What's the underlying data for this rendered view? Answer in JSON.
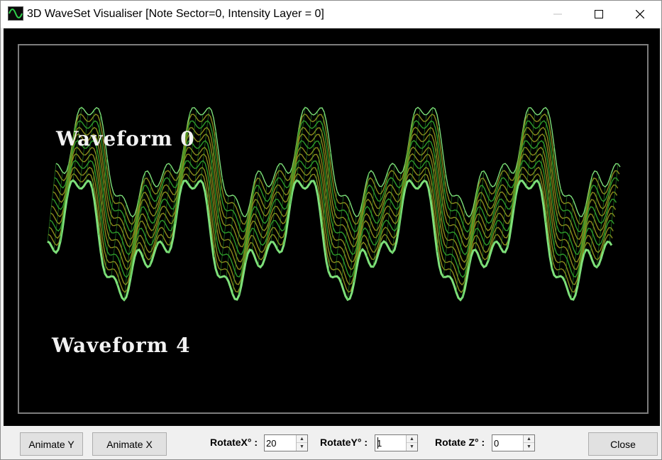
{
  "window": {
    "title": "3D WaveSet Visualiser [Note Sector=0, Intensity Layer = 0]",
    "minimize_glyph": "—",
    "maximize_glyph": "☐",
    "close_glyph": "✕"
  },
  "canvas": {
    "label_top": "Waveform 0",
    "label_bottom": "Waveform 4",
    "colors": {
      "background": "#000000",
      "front_wave": "#7ee07a",
      "back_wave": "#2e9a2a",
      "mid_wave": "#8a8a1c",
      "frame": "#7d7d7d"
    }
  },
  "toolbar": {
    "animate_y_label": "Animate Y",
    "animate_x_label": "Animate X",
    "rotate_x_label": "RotateX° :",
    "rotate_x_value": "20",
    "rotate_y_label": "RotateY° :",
    "rotate_y_value": "1",
    "rotate_z_label": "Rotate Z° :",
    "rotate_z_value": "0",
    "close_label": "Close"
  },
  "icons": {
    "app": "waveform-app-icon",
    "spin_up": "arrow-up-icon",
    "spin_down": "arrow-down-icon"
  }
}
